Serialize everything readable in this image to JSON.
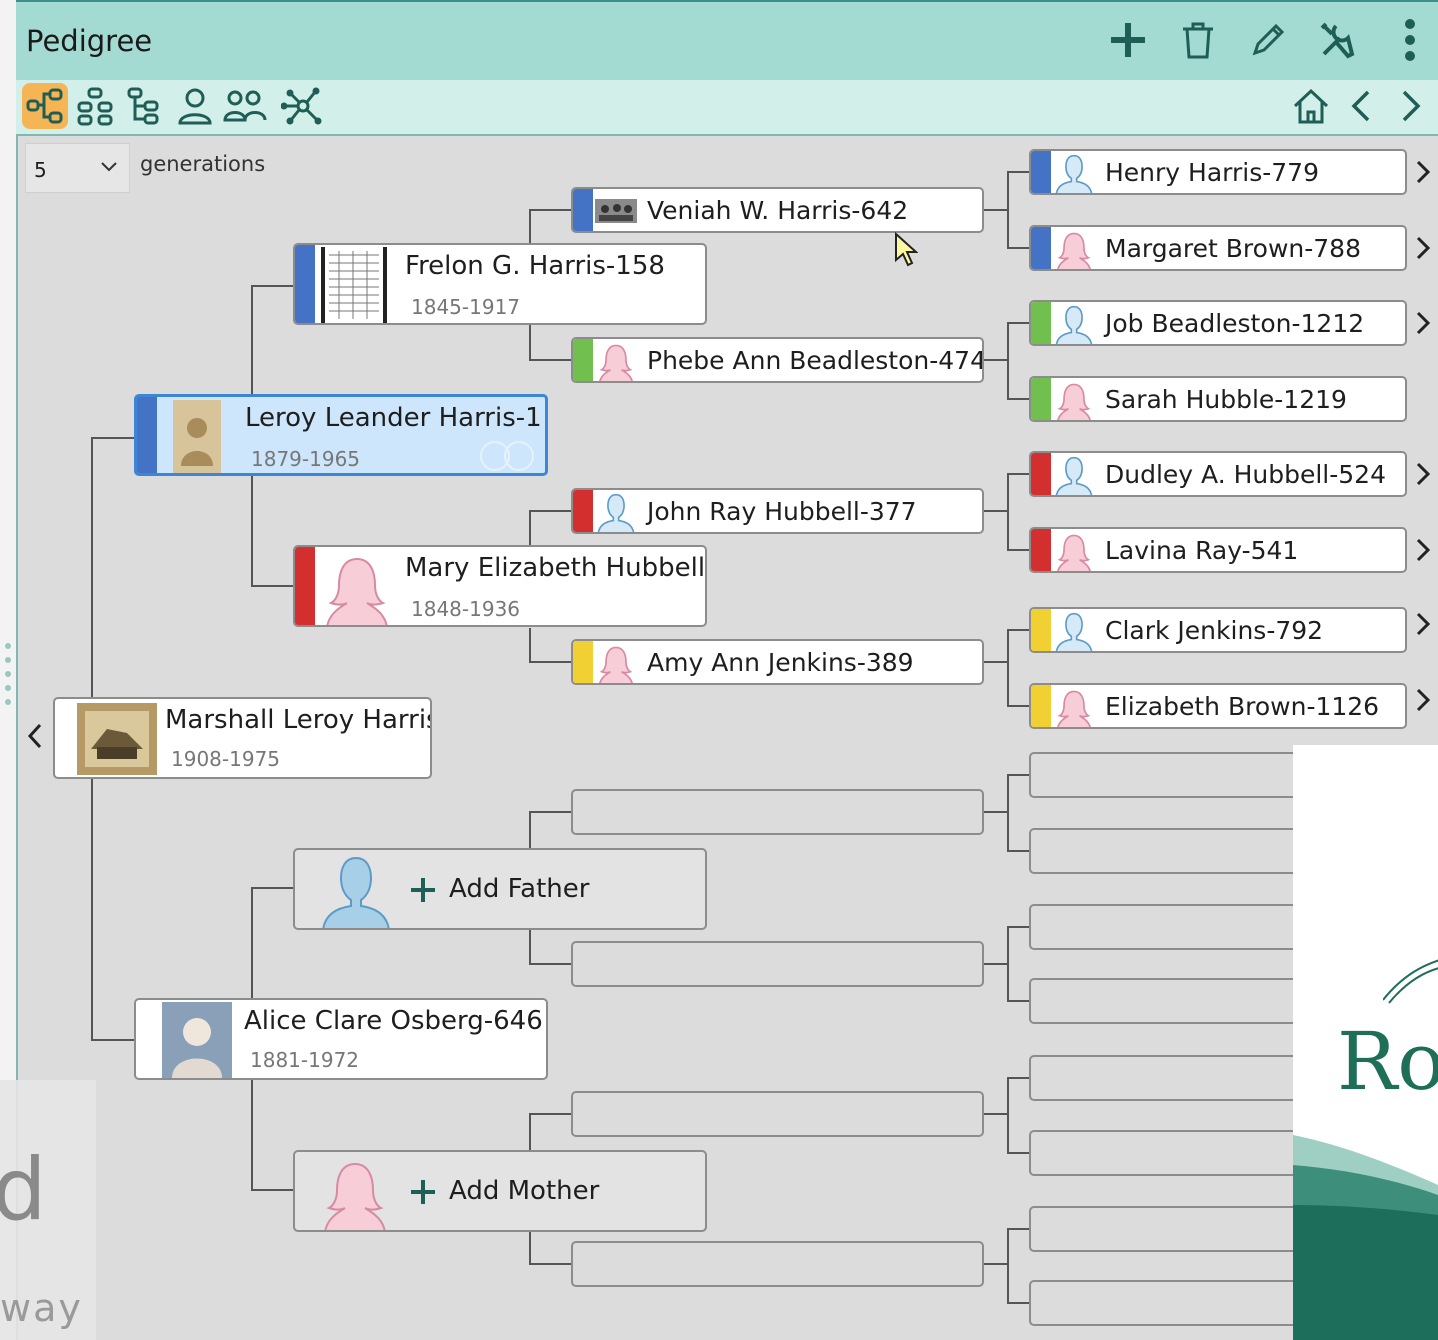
{
  "app": {
    "title": "Pedigree"
  },
  "colors": {
    "titlebar": "#a3dad2",
    "accent": "#1f5e56",
    "selected": "#cde6fb",
    "father_blue": "#4472c4",
    "family_green": "#70bf4f",
    "family_red": "#d32f2f",
    "family_yellow": "#f0d032"
  },
  "generations": {
    "value": "5",
    "label": "generations"
  },
  "people": {
    "root": {
      "name": "Marshall Leroy Harris-",
      "dates": "1908-1975"
    },
    "father": {
      "name": "Leroy Leander Harris-1",
      "dates": "1879-1965"
    },
    "mother": {
      "name": "Alice Clare Osberg-646",
      "dates": "1881-1972"
    },
    "pgf": {
      "name": "Frelon G. Harris-158",
      "dates": "1845-1917"
    },
    "pgm": {
      "name": "Mary Elizabeth Hubbell-:",
      "dates": "1848-1936"
    },
    "g3_1": {
      "name": "Veniah W. Harris-642"
    },
    "g3_2": {
      "name": "Phebe Ann Beadleston-474"
    },
    "g3_3": {
      "name": "John Ray Hubbell-377"
    },
    "g3_4": {
      "name": "Amy Ann Jenkins-389"
    },
    "g4_1": {
      "name": "Henry Harris-779"
    },
    "g4_2": {
      "name": "Margaret Brown-788"
    },
    "g4_3": {
      "name": "Job Beadleston-1212"
    },
    "g4_4": {
      "name": "Sarah Hubble-1219"
    },
    "g4_5": {
      "name": "Dudley A. Hubbell-524"
    },
    "g4_6": {
      "name": "Lavina Ray-541"
    },
    "g4_7": {
      "name": "Clark Jenkins-792"
    },
    "g4_8": {
      "name": "Elizabeth Brown-1126"
    }
  },
  "add": {
    "father": "Add Father",
    "mother": "Add Mother"
  },
  "watermark": {
    "letter": "d",
    "text": "way",
    "logo": "Ro"
  }
}
